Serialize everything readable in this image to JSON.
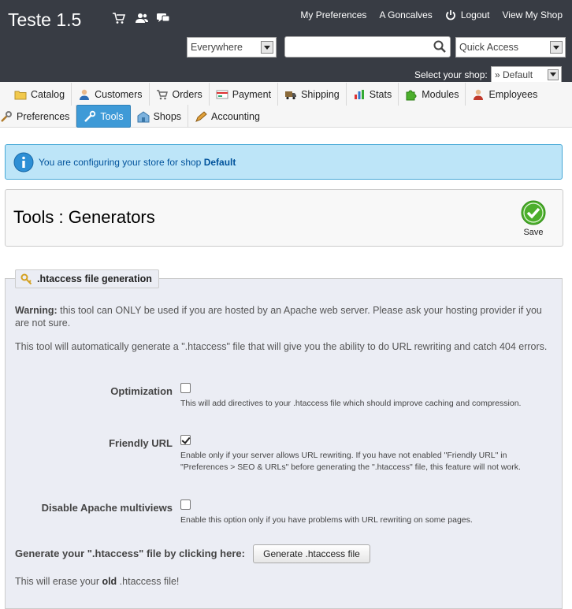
{
  "header": {
    "shop_title": "Teste 1.5",
    "links": {
      "my_preferences": "My Preferences",
      "employee": "A Goncalves",
      "logout": "Logout",
      "view_shop": "View My Shop"
    },
    "search_scope": "Everywhere",
    "search_value": "",
    "quick_access": "Quick Access",
    "shop_select_label": "Select your shop:",
    "shop_select_value": "» Default",
    "icons": [
      "cart-icon",
      "customers-icon",
      "messages-icon",
      "power-icon",
      "search-icon"
    ]
  },
  "tabs": {
    "row1": [
      {
        "label": "Catalog",
        "icon": "folder-icon"
      },
      {
        "label": "Customers",
        "icon": "customer-icon"
      },
      {
        "label": "Orders",
        "icon": "cart-icon"
      },
      {
        "label": "Payment",
        "icon": "payment-icon"
      },
      {
        "label": "Shipping",
        "icon": "truck-icon"
      },
      {
        "label": "Stats",
        "icon": "chart-icon"
      },
      {
        "label": "Modules",
        "icon": "puzzle-icon"
      },
      {
        "label": "Employees",
        "icon": "employee-icon"
      }
    ],
    "row2": [
      {
        "label": "Preferences",
        "icon": "wrench-icon"
      },
      {
        "label": "Tools",
        "icon": "tools-icon",
        "active": true
      },
      {
        "label": "Shops",
        "icon": "shop-icon"
      },
      {
        "label": "Accounting",
        "icon": "pencil-icon"
      }
    ]
  },
  "info": {
    "text": "You are configuring your store for shop ",
    "shop": "Default"
  },
  "toolbar": {
    "title": "Tools : Generators",
    "save_label": "Save"
  },
  "htaccess": {
    "legend": ".htaccess file generation",
    "warning_label": "Warning:",
    "warning_text": " this tool can ONLY be used if you are hosted by an Apache web server. Please ask your hosting provider if you are not sure.",
    "description": "This tool will automatically generate a \".htaccess\" file that will give you the ability to do URL rewriting and catch 404 errors.",
    "fields": [
      {
        "label": "Optimization",
        "checked": false,
        "hint": "This will add directives to your .htaccess file which should improve caching and compression."
      },
      {
        "label": "Friendly URL",
        "checked": true,
        "hint": "Enable only if your server allows URL rewriting. If you have not enabled \"Friendly URL\" in \"Preferences > SEO & URLs\" before generating the \".htaccess\" file, this feature will not work."
      },
      {
        "label": "Disable Apache multiviews",
        "checked": false,
        "hint": "Enable this option only if you have problems with URL rewriting on some pages."
      }
    ],
    "generate_label": "Generate your \".htaccess\" file by clicking here:",
    "generate_button": "Generate .htaccess file",
    "erase_pre": "This will erase your ",
    "erase_bold": "old",
    "erase_post": " .htaccess file!"
  },
  "colors": {
    "header_bg": "#383c44",
    "tab_active": "#3e9ad7",
    "info_bg": "#bde5f8",
    "info_text": "#00529b",
    "panel_bg": "#ebedf4",
    "save_green": "#4caf2c"
  }
}
